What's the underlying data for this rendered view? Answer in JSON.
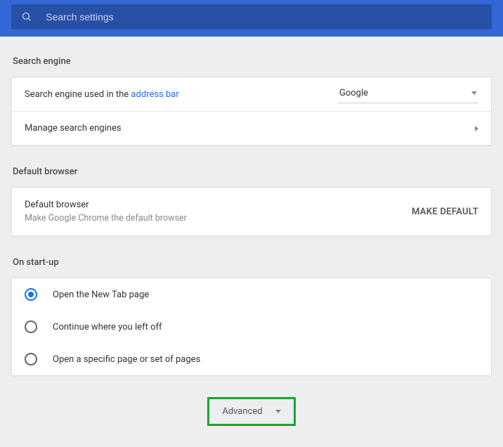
{
  "search": {
    "placeholder": "Search settings"
  },
  "search_engine": {
    "title": "Search engine",
    "used_in_label": "Search engine used in the ",
    "address_bar": "address bar",
    "selected": "Google",
    "manage_label": "Manage search engines"
  },
  "default_browser": {
    "title": "Default browser",
    "heading": "Default browser",
    "sub": "Make Google Chrome the default browser",
    "button": "MAKE DEFAULT"
  },
  "startup": {
    "title": "On start-up",
    "options": [
      {
        "label": "Open the New Tab page",
        "selected": true
      },
      {
        "label": "Continue where you left off",
        "selected": false
      },
      {
        "label": "Open a specific page or set of pages",
        "selected": false
      }
    ]
  },
  "advanced": {
    "label": "Advanced"
  }
}
